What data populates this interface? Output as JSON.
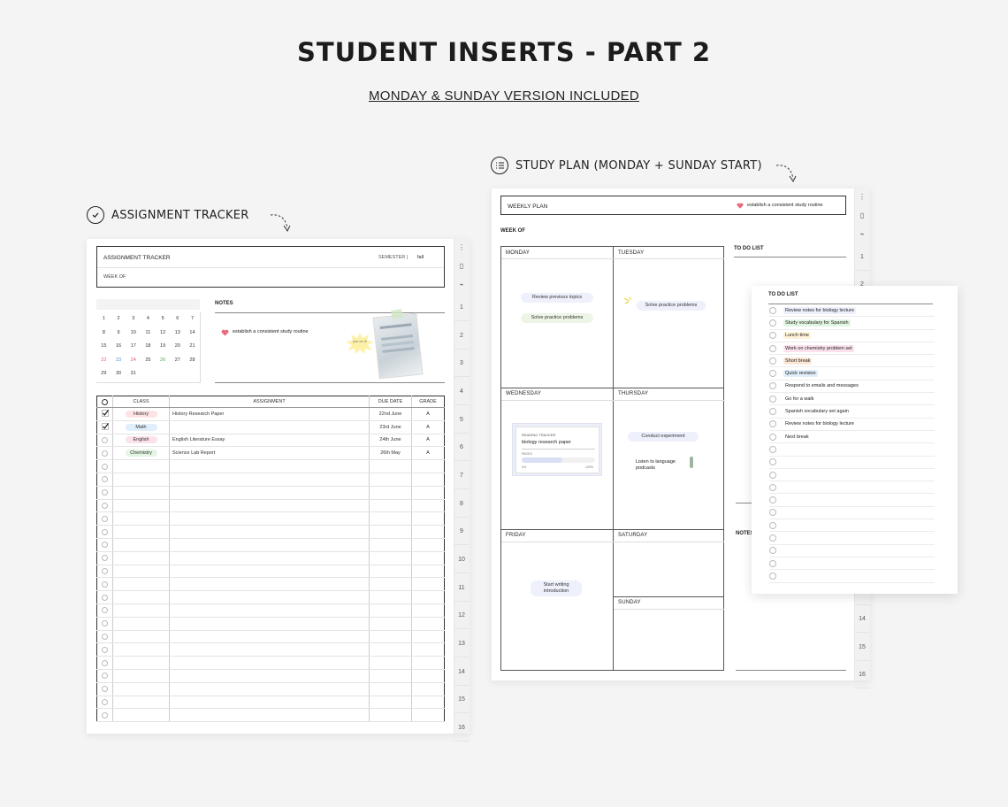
{
  "header": {
    "title": "STUDENT INSERTS - PART 2",
    "subtitle": "MONDAY & SUNDAY VERSION INCLUDED"
  },
  "sections": {
    "assignment_label": "ASSIGNMENT TRACKER",
    "study_label": "STUDY PLAN (MONDAY + SUNDAY START)"
  },
  "assignment_page": {
    "title": "ASSIGNMENT TRACKER",
    "semester_label": "SEMESTER |",
    "semester_value": "fall",
    "week_of": "WEEK OF",
    "notes_label": "NOTES",
    "note_text": "establish a consistent study routine",
    "sticker_text": "just do it!",
    "calendar": [
      [
        "1",
        "2",
        "3",
        "4",
        "5",
        "6",
        "7"
      ],
      [
        "8",
        "9",
        "10",
        "11",
        "12",
        "13",
        "14"
      ],
      [
        "15",
        "16",
        "17",
        "18",
        "19",
        "20",
        "21"
      ],
      [
        "22",
        "23",
        "24",
        "25",
        "26",
        "27",
        "28"
      ],
      [
        "29",
        "30",
        "31",
        "",
        "",
        "",
        ""
      ]
    ],
    "columns": {
      "class": "CLASS",
      "assignment": "ASSIGNMENT",
      "due": "DUE DATE",
      "grade": "GRADE"
    },
    "rows": [
      {
        "class": "History",
        "assignment": "History Research Paper",
        "due": "22nd June",
        "grade": "A",
        "checked": true,
        "color": "#fde3e3"
      },
      {
        "class": "Math",
        "assignment": "",
        "due": "23rd June",
        "grade": "A",
        "checked": true,
        "color": "#e1eefc"
      },
      {
        "class": "English",
        "assignment": "English Literature Essay",
        "due": "24th June",
        "grade": "A",
        "checked": false,
        "color": "#fbe2ec"
      },
      {
        "class": "Chemistry",
        "assignment": "Science Lab Report",
        "due": "26th May",
        "grade": "A",
        "checked": false,
        "color": "#e3f5e3"
      }
    ],
    "empty_rows": 20,
    "tabs": [
      "1",
      "2",
      "3",
      "4",
      "5",
      "6",
      "7",
      "8",
      "9",
      "10",
      "11",
      "12",
      "13",
      "14",
      "15",
      "16"
    ]
  },
  "weekly_page": {
    "title": "WEEKLY PLAN",
    "note_text": "establish a consistent study routine",
    "week_of": "WEEK OF",
    "days": {
      "monday": "MONDAY",
      "tuesday": "TUESDAY",
      "wednesday": "WEDNESDAY",
      "thursday": "THURSDAY",
      "friday": "FRIDAY",
      "saturday": "SATURDAY",
      "sunday": "SUNDAY"
    },
    "todo_label": "TO DO LIST",
    "notes_label": "NOTES",
    "tasks": {
      "mon1": "Review previous topics",
      "mon2": "Solve practice problems",
      "tue1": "Solve practice problems",
      "thu1": "Conduct experiment",
      "thu2": "Listen to language podcasts",
      "fri1": "Start writing introduction"
    },
    "reading_tracker": {
      "label": "READING TRACKER",
      "book": "biology research paper",
      "pages": "PAGES",
      "start": "0%",
      "end": "100%"
    },
    "tabs": [
      "1",
      "2",
      "3",
      "",
      "",
      "",
      "",
      "",
      "",
      "",
      "",
      "",
      "",
      "14",
      "15",
      "16"
    ]
  },
  "todo_page": {
    "title": "TO DO LIST",
    "items": [
      {
        "text": "Review notes for biology lecture",
        "color": "#eef0fb"
      },
      {
        "text": "Study vocabulary for Spanish",
        "color": "#e3f5e3"
      },
      {
        "text": "Lunch time",
        "color": "#fff4d9"
      },
      {
        "text": "Work on chemistry problem set",
        "color": "#fbe2ec"
      },
      {
        "text": "Short break",
        "color": "#fde8d8"
      },
      {
        "text": "Quick revision",
        "color": "#e1eefc"
      },
      {
        "text": "Respond to emails and messages",
        "color": ""
      },
      {
        "text": "Go for a walk",
        "color": ""
      },
      {
        "text": "Spanish vocabulary set again",
        "color": ""
      },
      {
        "text": "Review notes for biology lecture",
        "color": ""
      },
      {
        "text": "Next break",
        "color": ""
      }
    ],
    "empty_rows": 11
  }
}
